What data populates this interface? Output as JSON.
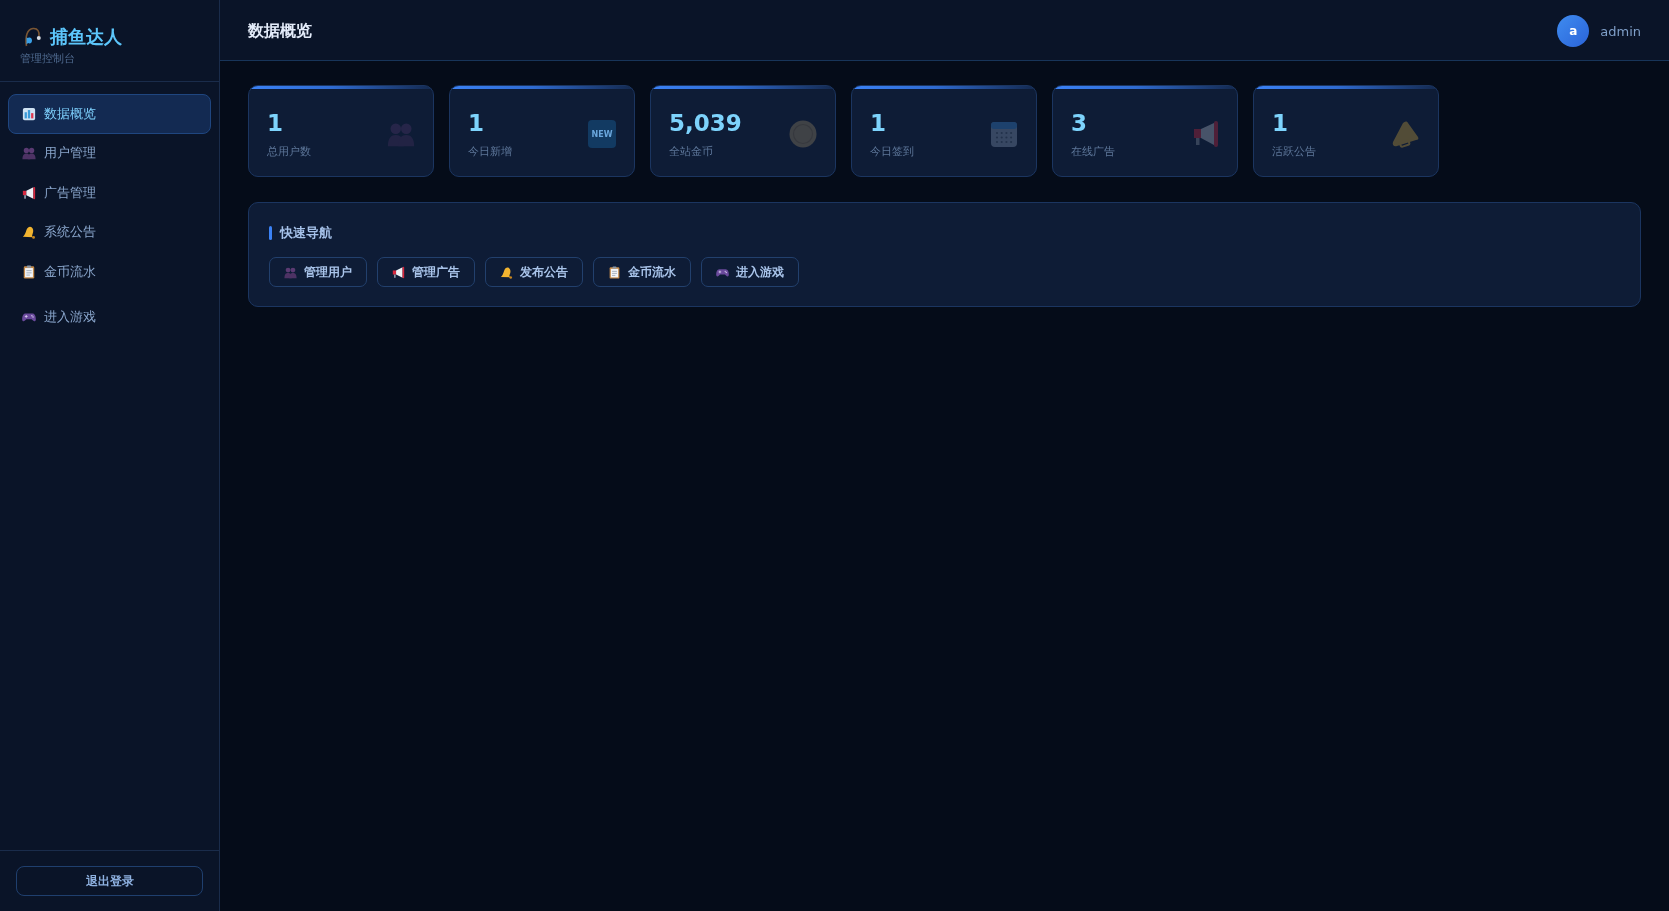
{
  "sidebar": {
    "brand": {
      "title": "捕鱼达人",
      "subtitle": "管理控制台"
    },
    "items": [
      {
        "label": "数据概览",
        "selected": true
      },
      {
        "label": "用户管理",
        "selected": false
      },
      {
        "label": "广告管理",
        "selected": false
      },
      {
        "label": "系统公告",
        "selected": false
      },
      {
        "label": "金币流水",
        "selected": false
      }
    ],
    "extra_items": [
      {
        "label": "进入游戏",
        "selected": false
      }
    ],
    "logout_button": "退出登录"
  },
  "header": {
    "title": "数据概览",
    "user": {
      "avatar_letter": "a",
      "name": "admin"
    }
  },
  "stats": [
    {
      "value": "1",
      "label": "总用户数"
    },
    {
      "value": "1",
      "label": "今日新增",
      "badge": "NEW"
    },
    {
      "value": "5,039",
      "label": "全站金币"
    },
    {
      "value": "1",
      "label": "今日签到"
    },
    {
      "value": "3",
      "label": "在线广告"
    },
    {
      "value": "1",
      "label": "活跃公告"
    }
  ],
  "quick_nav": {
    "title": "快速导航",
    "buttons": [
      "管理用户",
      "管理广告",
      "发布公告",
      "金币流水",
      "进入游戏"
    ]
  }
}
